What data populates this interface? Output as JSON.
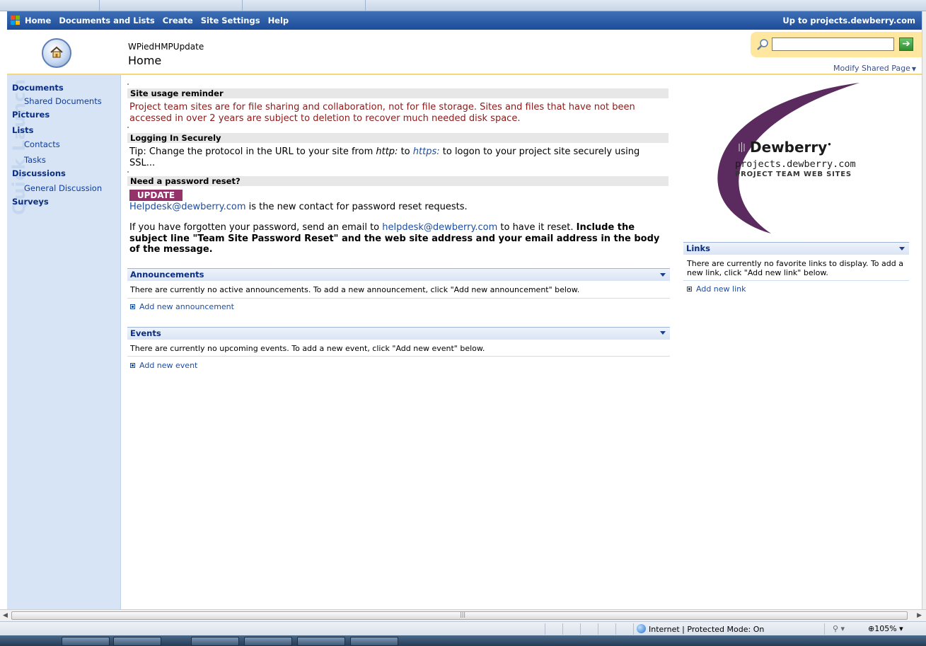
{
  "nav": {
    "links": [
      "Home",
      "Documents and Lists",
      "Create",
      "Site Settings",
      "Help"
    ],
    "up_link": "Up to projects.dewberry.com"
  },
  "header": {
    "site_name": "WPiedHMPUpdate",
    "page_name": "Home",
    "search_value": "",
    "modify_page": "Modify Shared Page"
  },
  "quicklaunch": {
    "watermark": "Quick Launch",
    "sections": [
      {
        "label": "Documents",
        "items": [
          "Shared Documents"
        ]
      },
      {
        "label": "Pictures",
        "items": []
      },
      {
        "label": "Lists",
        "items": [
          "Contacts",
          "Tasks"
        ]
      },
      {
        "label": "Discussions",
        "items": [
          "General Discussion"
        ]
      },
      {
        "label": "Surveys",
        "items": []
      }
    ]
  },
  "announcements_body": {
    "reminder_title": "Site usage reminder",
    "reminder_text": "Project team sites are for file sharing and collaboration, not for file storage.  Sites and files that have not been accessed in over 2 years are subject to deletion to recover much needed disk space.",
    "secure_title": "Logging In Securely",
    "secure_text_1": "Tip: Change the protocol in the URL to your site from ",
    "secure_http": "http:",
    "secure_to": " to ",
    "secure_https": "https:",
    "secure_text_2": " to logon to your project site securely using SSL...",
    "reset_title": "Need a password reset?",
    "update_badge": "UPDATE",
    "helpdesk_link": "Helpdesk@dewberry.com",
    "helpdesk_text": " is the new contact for password reset requests.",
    "forgot_text_1": "If you have forgotten your password, send an email to ",
    "forgot_link": "helpdesk@dewberry.com",
    "forgot_text_2": " to have it reset.  ",
    "forgot_bold": "Include the subject line \"Team Site Password Reset\" and the web site address and your email address in the body of the message."
  },
  "webparts": {
    "announcements": {
      "title": "Announcements",
      "empty": "There are currently no active announcements. To add a new announcement, click \"Add new announcement\" below.",
      "add_link": "Add new announcement"
    },
    "events": {
      "title": "Events",
      "empty": "There are currently no upcoming events. To add a new event, click \"Add new event\" below.",
      "add_link": "Add new event"
    },
    "links": {
      "title": "Links",
      "empty": "There are currently no favorite links to display. To add a new link, click \"Add new link\" below.",
      "add_link": "Add new link"
    }
  },
  "logo": {
    "brand": "Dewberry",
    "url": "projects.dewberry.com",
    "tagline": "PROJECT TEAM WEB SITES",
    "color": "#5b2a5e"
  },
  "status": {
    "zone": "Internet | Protected Mode: On",
    "zoom": "105%"
  },
  "colors": {
    "nav_bar": "#1d4d99",
    "quick_launch": "#d6e4f5",
    "search_box": "#ffe7a0",
    "reminder_text": "#8b1a1a",
    "update_badge": "#93336a",
    "link": "#1d4da0"
  }
}
